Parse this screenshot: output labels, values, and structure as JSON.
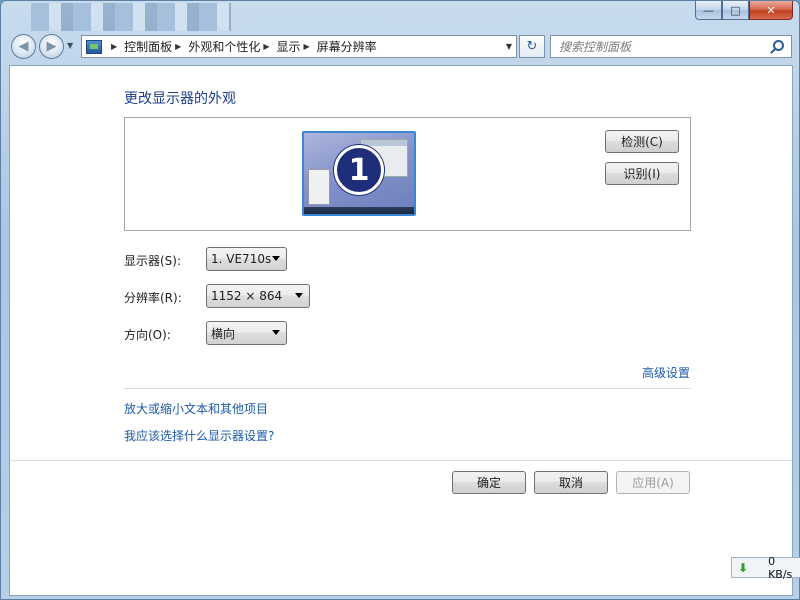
{
  "window": {
    "minimize": "—",
    "maximize": "□",
    "close": "✕"
  },
  "nav": {
    "back": "◀",
    "forward": "▶",
    "breadcrumb": [
      "控制面板",
      "外观和个性化",
      "显示",
      "屏幕分辨率"
    ],
    "refresh": "↻",
    "search_placeholder": "搜索控制面板"
  },
  "page": {
    "title": "更改显示器的外观",
    "monitor_number": "1",
    "detect_label": "检测(C)",
    "identify_label": "识别(I)",
    "display_label": "显示器(S):",
    "display_value": "1. VE710s",
    "resolution_label": "分辨率(R):",
    "resolution_value": "1152 × 864",
    "orientation_label": "方向(O):",
    "orientation_value": "横向",
    "advanced_link": "高级设置",
    "link_text_size": "放大或缩小文本和其他项目",
    "link_which_settings": "我应该选择什么显示器设置?",
    "ok_label": "确定",
    "cancel_label": "取消",
    "apply_label": "应用(A)"
  },
  "status": {
    "download": "0 KB/s"
  }
}
